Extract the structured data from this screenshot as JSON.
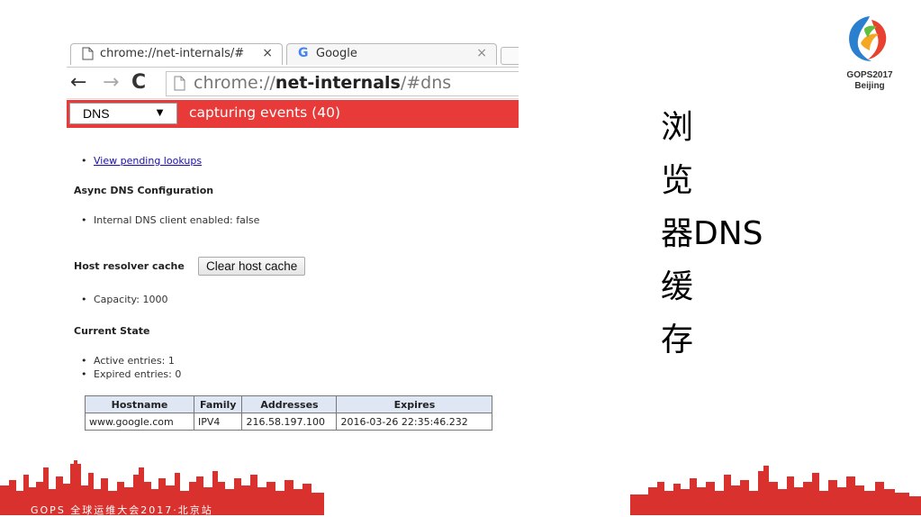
{
  "browser": {
    "tabs": [
      {
        "title": "chrome://net-internals/#",
        "close": "×",
        "active": true
      },
      {
        "title": "Google",
        "icon_letter": "G",
        "close": "×",
        "active": false
      }
    ],
    "nav": {
      "back": "←",
      "forward": "→",
      "reload": "C"
    },
    "url": {
      "prefix": "chrome://",
      "bold": "net-internals",
      "suffix": "/#dns"
    }
  },
  "net_internals": {
    "section_select": {
      "value": "DNS",
      "arrow": "▼"
    },
    "status": "capturing events (40)",
    "view_pending_link": "View pending lookups",
    "async_heading": "Async DNS Configuration",
    "internal_dns_item": "Internal DNS client enabled: false",
    "host_cache_heading": "Host resolver cache",
    "clear_cache_button": "Clear host cache",
    "capacity_item": "Capacity: 1000",
    "current_state_heading": "Current State",
    "active_entries_item": "Active entries: 1",
    "expired_entries_item": "Expired entries: 0",
    "table": {
      "headers": [
        "Hostname",
        "Family",
        "Addresses",
        "Expires"
      ],
      "rows": [
        [
          "www.google.com",
          "IPV4",
          "216.58.197.100",
          "2016-03-26 22:35:46.232"
        ]
      ]
    }
  },
  "slide": {
    "title_lines": [
      "浏",
      "览",
      "器DNS",
      "缓",
      "存"
    ],
    "logo_line1": "GOPS2017",
    "logo_line2": "Beijing",
    "footer": "GOPS 全球运维大会2017·北京站"
  },
  "colors": {
    "net_internals_bar": "#e93a3a",
    "skyline": "#d9322e",
    "table_header": "#dfe7f5",
    "link": "#1a0dab"
  }
}
